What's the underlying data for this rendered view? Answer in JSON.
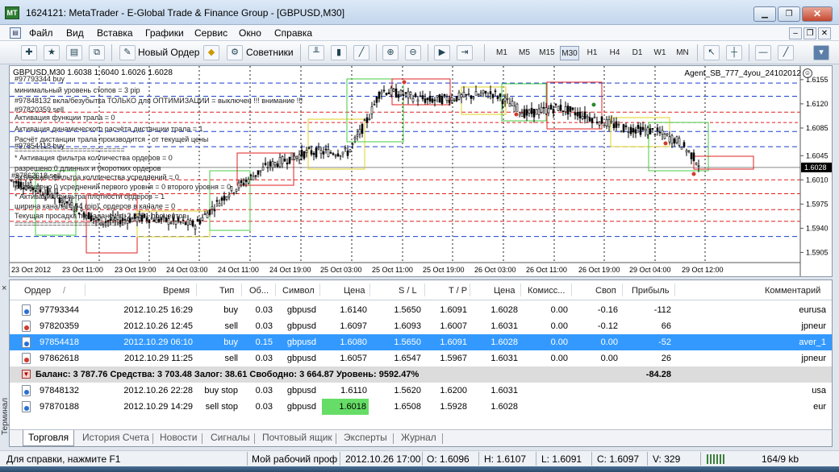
{
  "window": {
    "title": "1624121: MetaTrader - E-Global Trade & Finance Group - [GBPUSD,M30]",
    "icon_glyph": "MT",
    "min_glyph": "▁",
    "max_glyph": "❐",
    "close_glyph": "✕"
  },
  "menu": {
    "items": [
      "Файл",
      "Вид",
      "Вставка",
      "Графики",
      "Сервис",
      "Окно",
      "Справка"
    ],
    "mdi_min": "–",
    "mdi_restore": "❐",
    "mdi_close": "✕"
  },
  "toolbar": {
    "new_order": "Новый Ордер",
    "advisors": "Советники",
    "timeframes": [
      "M1",
      "M5",
      "M15",
      "M30",
      "H1",
      "H4",
      "D1",
      "W1",
      "MN"
    ],
    "active_timeframe": "M30",
    "icon_glyphs": {
      "new-chart": "✚",
      "favorites": "★",
      "market-watch": "▤",
      "navigator": "⧉",
      "warning": "◆",
      "bar-chart": "╨",
      "candle-chart": "▮",
      "line-chart": "╱",
      "zoom-in": "⊕",
      "zoom-out": "⊖",
      "autoscroll": "▶",
      "chart-shift": "⇥",
      "cursor": "↖",
      "crosshair": "┼",
      "hline": "—",
      "trendline": "╱",
      "more": "▾"
    }
  },
  "chart": {
    "header": "GBPUSD,M30  1.6038 1.6040 1.6026 1.6028",
    "ea_label": "Agent_SB_777_4you_24102012",
    "ea_smile": "☺",
    "current_price": "1.6028",
    "price_levels": [
      "1.6155",
      "1.6120",
      "1.6085",
      "1.6045",
      "1.6010",
      "1.5975",
      "1.5940",
      "1.5905"
    ],
    "time_labels": [
      "23 Oct 2012",
      "23 Oct 11:00",
      "23 Oct 19:00",
      "24 Oct 03:00",
      "24 Oct 11:00",
      "24 Oct 19:00",
      "25 Oct 03:00",
      "25 Oct 11:00",
      "25 Oct 19:00",
      "26 Oct 03:00",
      "26 Oct 11:00",
      "26 Oct 19:00",
      "29 Oct 04:00",
      "29 Oct 12:00"
    ],
    "overlay_lines": [
      "#97793344 buy",
      "минимальный уровень стопов =  3  pip",
      "#97848132 вкла/безубытка ТОЛЬКО для ОПТИМИЗАЦИИ =  выключен  !!! внимание !!!",
      "#97820359 sell",
      "Активация функции трала = 0",
      "Активация динамического расчёта дистанции трала =  1",
      "Расчёт дистанции трала производится - от текущей цены",
      "#97854418 buy",
      "==========================",
      "*  Активация фильтра колличества ордеров =  0",
      "разрешено 0 длинных и 0коротких ордеров",
      "Активация фильтра колличества усреднений =  0",
      "разрешено 0 усреднений первого уровня =  0 второго уровня =  0",
      "*  Активация фильтра плотности ордеров =  1",
      "ширина канала = 54 (pip), ордеров в канале =  0",
      "Текущая просадка по балансу =  -2.2251 процентов",
      "==========================",
      "#97862618 sell"
    ]
  },
  "terminal": {
    "close_glyph": "×",
    "side_label": "Терминал",
    "sort_glyph": "/",
    "columns": [
      "Ордер",
      "Время",
      "Тип",
      "Об...",
      "Символ",
      "Цена",
      "S / L",
      "T / P",
      "Цена",
      "Комисс...",
      "Своп",
      "Прибыль",
      "Комментарий"
    ],
    "orders": [
      {
        "order": "97793344",
        "time": "2012.10.25 16:29",
        "type": "buy",
        "volume": "0.03",
        "symbol": "gbpusd",
        "price": "1.6140",
        "sl": "1.5650",
        "tp": "1.6091",
        "cur": "1.6028",
        "commission": "0.00",
        "swap": "-0.16",
        "profit": "-112",
        "comment": "eurusa"
      },
      {
        "order": "97820359",
        "time": "2012.10.26 12:45",
        "type": "sell",
        "volume": "0.03",
        "symbol": "gbpusd",
        "price": "1.6097",
        "sl": "1.6093",
        "tp": "1.6007",
        "cur": "1.6031",
        "commission": "0.00",
        "swap": "-0.12",
        "profit": "66",
        "comment": "jpneur"
      },
      {
        "order": "97854418",
        "time": "2012.10.29 06:10",
        "type": "buy",
        "volume": "0.15",
        "symbol": "gbpusd",
        "price": "1.6080",
        "sl": "1.5650",
        "tp": "1.6091",
        "cur": "1.6028",
        "commission": "0.00",
        "swap": "0.00",
        "profit": "-52",
        "comment": "aver_1"
      },
      {
        "order": "97862618",
        "time": "2012.10.29 11:25",
        "type": "sell",
        "volume": "0.03",
        "symbol": "gbpusd",
        "price": "1.6057",
        "sl": "1.6547",
        "tp": "1.5967",
        "cur": "1.6031",
        "commission": "0.00",
        "swap": "0.00",
        "profit": "26",
        "comment": "jpneur"
      }
    ],
    "balance_line": "Баланс: 3 787.76  Средства: 3 703.48  Залог: 38.61  Свободно: 3 664.87  Уровень: 9592.47%",
    "balance_total": "-84.28",
    "pending": [
      {
        "order": "97848132",
        "time": "2012.10.26 22:28",
        "type": "buy stop",
        "volume": "0.03",
        "symbol": "gbpusd",
        "price": "1.6110",
        "sl": "1.5620",
        "tp": "1.6200",
        "cur": "1.6031",
        "comment": "usa"
      },
      {
        "order": "97870188",
        "time": "2012.10.29 14:29",
        "type": "sell stop",
        "volume": "0.03",
        "symbol": "gbpusd",
        "price": "1.6018",
        "sl": "1.6508",
        "tp": "1.5928",
        "cur": "1.6028",
        "comment": "eur"
      }
    ],
    "tabs": [
      "Торговля",
      "История Счета",
      "Новости",
      "Сигналы",
      "Почтовый ящик",
      "Эксперты",
      "Журнал"
    ],
    "active_tab": "Торговля"
  },
  "status": {
    "help": "Для справки, нажмите F1",
    "profile": "Мой рабочий проф",
    "datetime": "2012.10.26 17:00",
    "open": "O: 1.6096",
    "high": "H: 1.6107",
    "low": "L: 1.6091",
    "close": "C: 1.6097",
    "volume": "V: 329",
    "traffic": "164/9 kb"
  },
  "colors": {
    "selected_row": "#3399ff",
    "highlight_cell": "#66dd66",
    "current_price_bg": "#000000"
  }
}
